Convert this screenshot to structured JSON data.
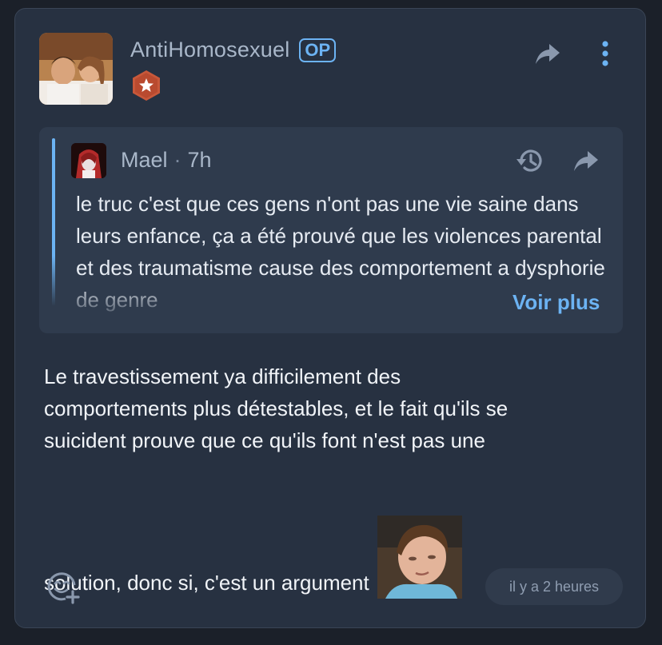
{
  "post": {
    "author": "AntiHomosexuel",
    "op_label": "OP",
    "rank_icon": "star-hexagon-badge",
    "accent_color": "#6cb3f3",
    "quote": {
      "author": "Mael",
      "separator": "·",
      "time": "7h",
      "text": "le truc c'est que ces gens n'ont pas une vie saine dans leurs enfance, ça a été prouvé que les violences parental et des traumatisme cause des comportement a dysphorie de genre",
      "more_label": "Voir plus"
    },
    "body_lines": [
      "Le travestissement ya difficilement des",
      "comportements plus détestables, et le fait qu'ils se",
      "suicident prouve que ce qu'ils font n'est pas une"
    ],
    "body_last_line": "solution, donc si, c'est un argument",
    "timestamp": "il y a 2 heures"
  }
}
